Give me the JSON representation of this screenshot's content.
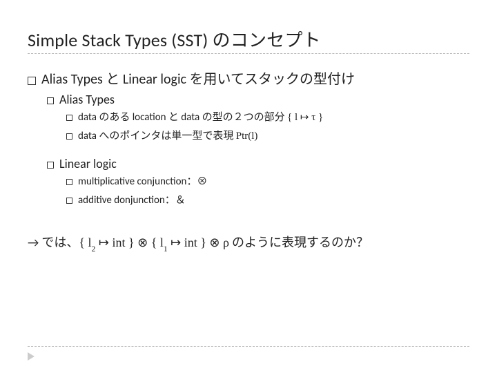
{
  "title": "Simple Stack Types (SST) のコンセプト",
  "l1": "Alias Types と Linear logic を用いてスタックの型付け",
  "alias": {
    "heading": "Alias Types",
    "item1_pre": "data のある location と data の型の２つの部分   ",
    "item1_formula": "{ l ↦ τ }",
    "item2_pre": "data へのポインタは単一型で表現   ",
    "item2_formula": "Ptr(l)"
  },
  "linear": {
    "heading": "Linear logic",
    "item1": "multiplicative conjunction：⊗",
    "item2": "additive donjunction：＆"
  },
  "final": {
    "arrow": "→ では、",
    "f1a": "{ l",
    "s2": "2",
    "f1b": " ↦ int } ",
    "tensor": "⊗",
    "f2a": " { l",
    "s1": "1",
    "f2b": " ↦ int } ",
    "rho": " ρ",
    "tail": "  のように表現するのか？"
  }
}
